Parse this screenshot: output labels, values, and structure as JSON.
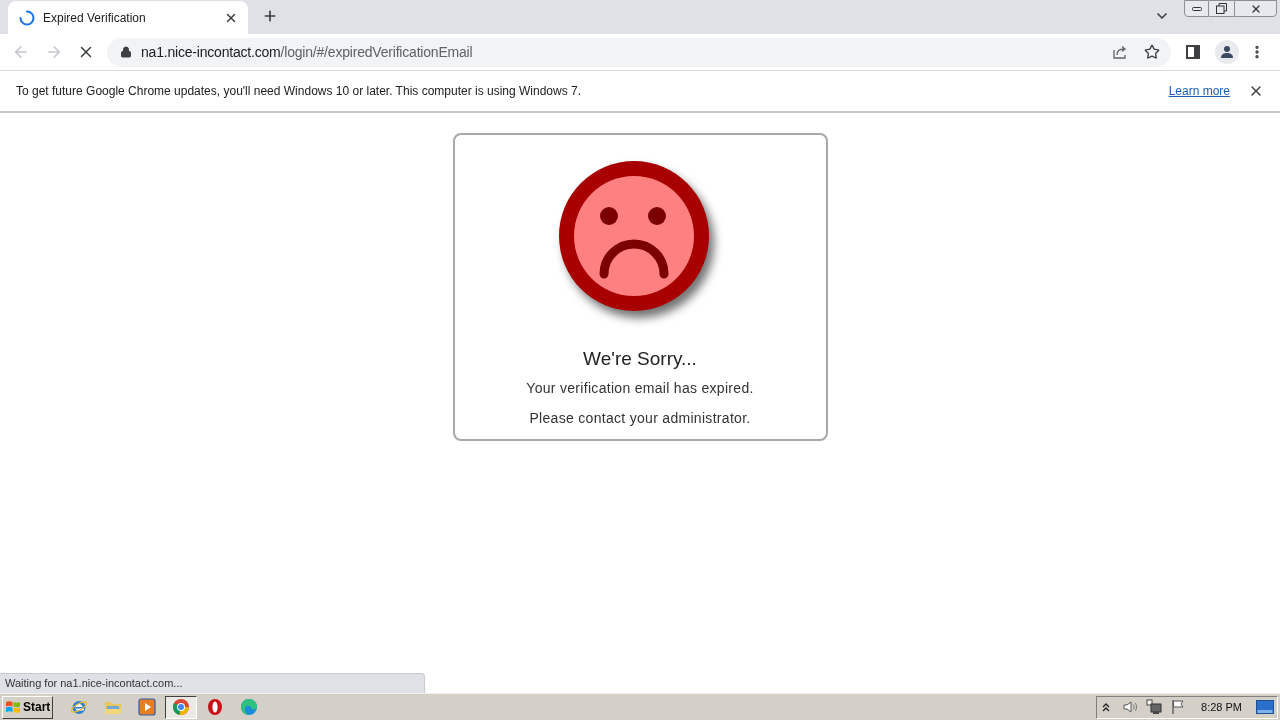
{
  "tab": {
    "title": "Expired Verification",
    "loading": true
  },
  "address_bar": {
    "host": "na1.nice-incontact.com",
    "path": "/login/#/expiredVerificationEmail"
  },
  "infobar": {
    "message": "To get future Google Chrome updates, you'll need Windows 10 or later. This computer is using Windows 7.",
    "link": "Learn more"
  },
  "card": {
    "title": "We're Sorry...",
    "lines": [
      "Your verification email has expired.",
      "Please contact your administrator."
    ]
  },
  "status_bubble": "Waiting for na1.nice-incontact.com...",
  "taskbar": {
    "start": "Start",
    "apps": [
      {
        "kind": "ie",
        "selected": false
      },
      {
        "kind": "explorer",
        "selected": false
      },
      {
        "kind": "media",
        "selected": false
      },
      {
        "kind": "chrome",
        "selected": true
      },
      {
        "kind": "opera",
        "selected": false
      },
      {
        "kind": "edge",
        "selected": false
      }
    ],
    "clock": "8:28 PM"
  }
}
